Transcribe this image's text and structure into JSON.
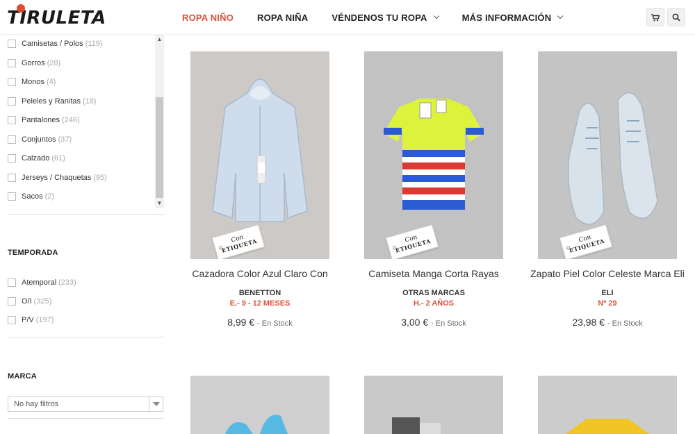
{
  "header": {
    "logo_text": "TIRULETA",
    "nav": [
      {
        "label": "ROPA NIÑO",
        "active": true,
        "dropdown": false
      },
      {
        "label": "ROPA NIÑA",
        "active": false,
        "dropdown": false
      },
      {
        "label": "VÉNDENOS TU ROPA",
        "active": false,
        "dropdown": true
      },
      {
        "label": "MÁS INFORMACIÓN",
        "active": false,
        "dropdown": true
      }
    ],
    "cart_icon": "cart-icon",
    "search_icon": "search-icon"
  },
  "sidebar": {
    "categories": [
      {
        "label": "Camisetas / Polos",
        "count": "(119)"
      },
      {
        "label": "Gorros",
        "count": "(28)"
      },
      {
        "label": "Monos",
        "count": "(4)"
      },
      {
        "label": "Peleles y Ranitas",
        "count": "(18)"
      },
      {
        "label": "Pantalones",
        "count": "(246)"
      },
      {
        "label": "Conjuntos",
        "count": "(37)"
      },
      {
        "label": "Calzado",
        "count": "(61)"
      },
      {
        "label": "Jerseys / Chaquetas",
        "count": "(95)"
      },
      {
        "label": "Sacos",
        "count": "(2)"
      }
    ],
    "season_title": "TEMPORADA",
    "seasons": [
      {
        "label": "Atemporal",
        "count": "(233)"
      },
      {
        "label": "O/I",
        "count": "(325)"
      },
      {
        "label": "P/V",
        "count": "(197)"
      }
    ],
    "brand_title": "MARCA",
    "brand_select": "No hay filtros"
  },
  "products": [
    {
      "name": "Cazadora Color Azul Claro Con",
      "brand": "BENETTON",
      "size": "E.- 9 - 12 MESES",
      "price": "8,99 €",
      "stock": "- En Stock",
      "tag_line1": "Con",
      "tag_line2": "ETIQUETA",
      "kind": "jacket"
    },
    {
      "name": "Camiseta Manga Corta Rayas",
      "brand": "OTRAS MARCAS",
      "size": "H.- 2 AÑOS",
      "price": "3,00 €",
      "stock": "- En Stock",
      "tag_line1": "Con",
      "tag_line2": "ETIQUETA",
      "kind": "tshirt"
    },
    {
      "name": "Zapato Piel Color Celeste Marca Eli",
      "brand": "ELI",
      "size": "Nº 29",
      "price": "23,98 €",
      "stock": "- En Stock",
      "tag_line1": "Con",
      "tag_line2": "ETIQUETA",
      "kind": "shoes"
    }
  ],
  "colors": {
    "accent": "#d9533b",
    "text": "#333333"
  }
}
